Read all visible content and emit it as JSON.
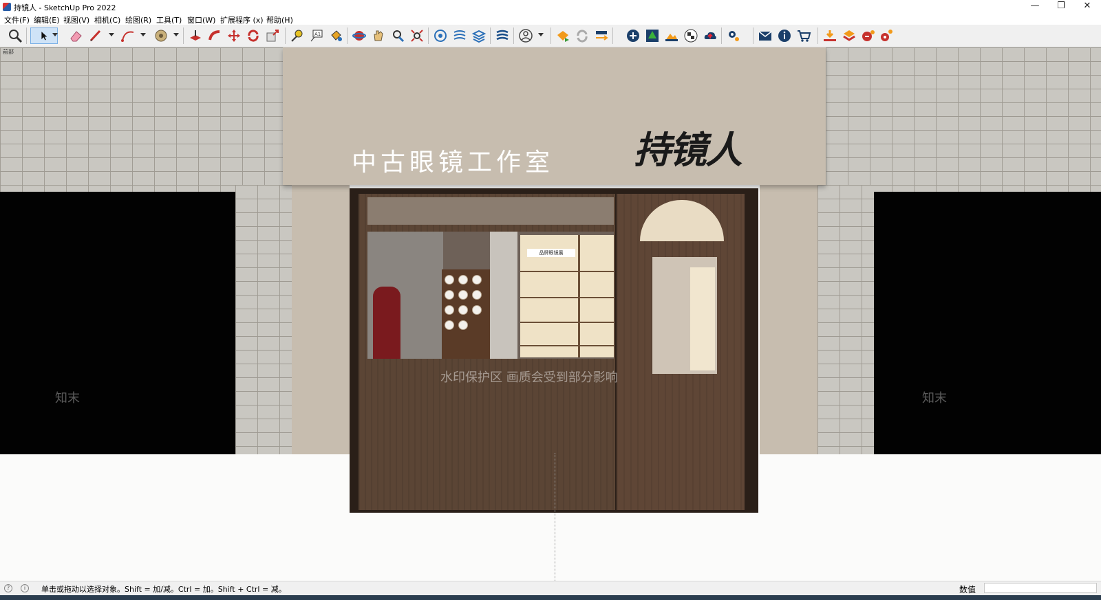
{
  "window": {
    "title": "持镜人 - SketchUp Pro 2022",
    "minimize": "—",
    "restore": "❐",
    "close": "✕"
  },
  "menu": {
    "items": [
      "文件(F)",
      "编辑(E)",
      "视图(V)",
      "相机(C)",
      "绘图(R)",
      "工具(T)",
      "窗口(W)",
      "扩展程序 (x)",
      "帮助(H)"
    ]
  },
  "toolbar": {
    "tools": [
      "zoom-icon",
      "select-icon",
      "eraser-icon",
      "pencil-icon",
      "arc-icon",
      "shapes-icon",
      "push-pull-icon",
      "follow-me-icon",
      "move-icon",
      "rotate-icon",
      "scale-icon",
      "tape-measure-icon",
      "text-icon",
      "paint-bucket-icon",
      "orbit-icon",
      "pan-icon",
      "zoom-window-icon",
      "zoom-extents-icon",
      "warehouse-icon",
      "layout-icon",
      "extension-warehouse-icon",
      "style-builder-icon",
      "profile-icon",
      "logo-orange-icon",
      "refresh-icon",
      "export-icon",
      "add-icon",
      "tree-icon",
      "terrain-icon",
      "checker-icon",
      "cloud-upload-icon",
      "settings-icon",
      "mail-icon",
      "info-icon",
      "cart-icon",
      "download-icon",
      "import-icon",
      "plugin-a-icon",
      "plugin-b-icon"
    ]
  },
  "viewport": {
    "scene_tab": "前部",
    "sign_text": "中古眼镜工作室",
    "brand_logo": "持镜人",
    "watermark_main": "水印保护区   画质会受到部分影响",
    "watermark_brand": "知末",
    "shelf_label": "品牌眼镜展"
  },
  "status": {
    "hint": "单击或拖动以选择对象。Shift = 加/减。Ctrl = 加。Shift + Ctrl = 减。",
    "measure_label": "数值",
    "measure_value": ""
  },
  "colors": {
    "sign": "#c7bdaf",
    "wood": "#5b4535",
    "brick": "#c9c7c1",
    "toolbar_bg": "#f0f0f0"
  }
}
